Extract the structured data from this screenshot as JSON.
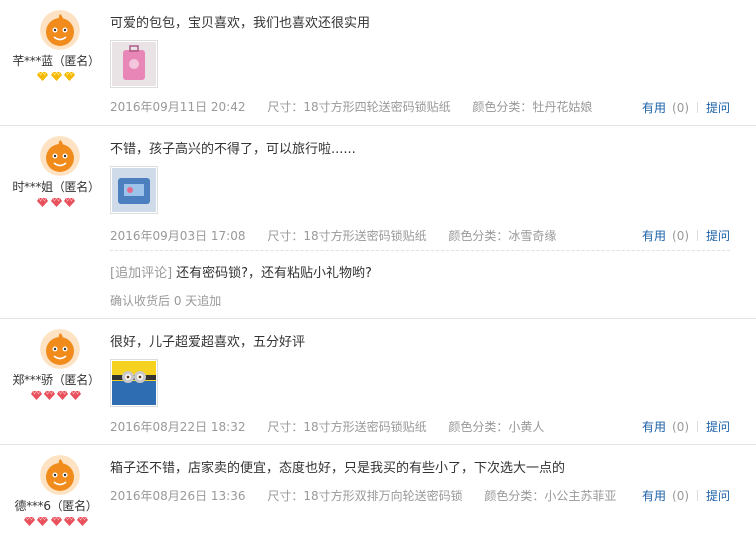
{
  "reviews": [
    {
      "username": "芊***蓝（匿名）",
      "badge_type": "gold",
      "badge_count": 3,
      "content": "可爱的包包，宝贝喜欢，我们也喜欢还很实用",
      "has_photo": true,
      "date": "2016年09月11日 20:42",
      "size": "尺寸：18寸方形四轮送密码锁贴纸",
      "color": "颜色分类：牡丹花姑娘",
      "useful_label": "有用",
      "useful_count": "(0)",
      "ask_label": "提问"
    },
    {
      "username": "时***姐（匿名）",
      "badge_type": "red",
      "badge_count": 3,
      "content": "不错，孩子高兴的不得了，可以旅行啦......",
      "has_photo": true,
      "date": "2016年09月03日 17:08",
      "size": "尺寸：18寸方形送密码锁贴纸",
      "color": "颜色分类：冰雪奇缘",
      "useful_label": "有用",
      "useful_count": "(0)",
      "ask_label": "提问",
      "append_tag": "[追加评论]",
      "append_text": "还有密码锁?，还有粘贴小礼物哟?",
      "append_after": "确认收货后 0 天追加"
    },
    {
      "username": "郑***骄（匿名）",
      "badge_type": "red",
      "badge_count": 4,
      "content": "很好，儿子超爱超喜欢，五分好评",
      "has_photo": true,
      "date": "2016年08月22日 18:32",
      "size": "尺寸：18寸方形送密码锁贴纸",
      "color": "颜色分类：小黄人",
      "useful_label": "有用",
      "useful_count": "(0)",
      "ask_label": "提问"
    },
    {
      "username": "德***6（匿名）",
      "badge_type": "red",
      "badge_count": 5,
      "content": "箱子还不错，店家卖的便宜，态度也好，只是我买的有些小了，下次选大一点的",
      "has_photo": false,
      "date": "2016年08月26日 13:36",
      "size": "尺寸：18寸方形双排万向轮送密码锁",
      "color": "颜色分类：小公主苏菲亚",
      "useful_label": "有用",
      "useful_count": "(0)",
      "ask_label": "提问"
    }
  ],
  "colors": {
    "link": "#1c61a8",
    "meta": "#999999",
    "avatar": "#f08b1c",
    "gold_badge": "#f5b800",
    "red_badge": "#e8505b"
  }
}
